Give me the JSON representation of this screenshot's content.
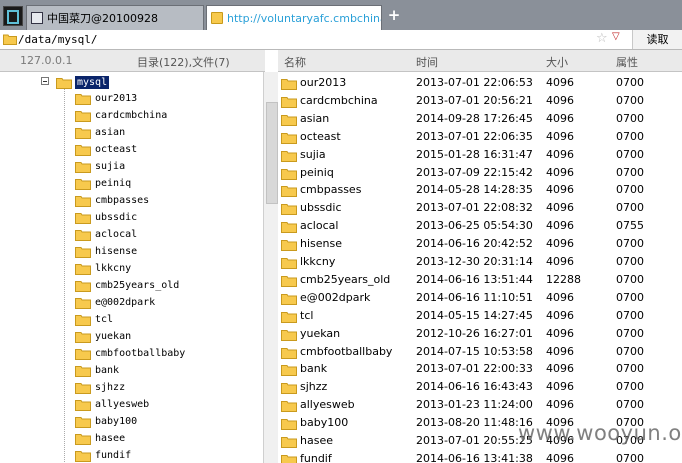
{
  "tabs": [
    {
      "label": "中国菜刀@20100928"
    },
    {
      "label": "http://voluntaryafc.cmbchina...."
    }
  ],
  "new_tab_label": "+",
  "address": {
    "value": "/data/mysql/",
    "star": "☆",
    "caret": "▽",
    "read_button": "读取"
  },
  "left_header": {
    "host": "127.0.0.1",
    "counts": "目录(122),文件(7)"
  },
  "columns": {
    "name": "名称",
    "time": "时间",
    "size": "大小",
    "perm": "属性"
  },
  "tree": {
    "root": "mysql",
    "children": [
      "our2013",
      "cardcmbchina",
      "asian",
      "octeast",
      "sujia",
      "peiniq",
      "cmbpasses",
      "ubssdic",
      "aclocal",
      "hisense",
      "lkkcny",
      "cmb25years_old",
      "e@002dpark",
      "tcl",
      "yuekan",
      "cmbfootballbaby",
      "bank",
      "sjhzz",
      "allyesweb",
      "baby100",
      "hasee",
      "fundif"
    ]
  },
  "files": [
    {
      "name": "our2013",
      "time": "2013-07-01 22:06:53",
      "size": "4096",
      "perm": "0700"
    },
    {
      "name": "cardcmbchina",
      "time": "2013-07-01 20:56:21",
      "size": "4096",
      "perm": "0700"
    },
    {
      "name": "asian",
      "time": "2014-09-28 17:26:45",
      "size": "4096",
      "perm": "0700"
    },
    {
      "name": "octeast",
      "time": "2013-07-01 22:06:35",
      "size": "4096",
      "perm": "0700"
    },
    {
      "name": "sujia",
      "time": "2015-01-28 16:31:47",
      "size": "4096",
      "perm": "0700"
    },
    {
      "name": "peiniq",
      "time": "2013-07-09 22:15:42",
      "size": "4096",
      "perm": "0700"
    },
    {
      "name": "cmbpasses",
      "time": "2014-05-28 14:28:35",
      "size": "4096",
      "perm": "0700"
    },
    {
      "name": "ubssdic",
      "time": "2013-07-01 22:08:32",
      "size": "4096",
      "perm": "0700"
    },
    {
      "name": "aclocal",
      "time": "2013-06-25 05:54:30",
      "size": "4096",
      "perm": "0755"
    },
    {
      "name": "hisense",
      "time": "2014-06-16 20:42:52",
      "size": "4096",
      "perm": "0700"
    },
    {
      "name": "lkkcny",
      "time": "2013-12-30 20:31:14",
      "size": "4096",
      "perm": "0700"
    },
    {
      "name": "cmb25years_old",
      "time": "2014-06-16 13:51:44",
      "size": "12288",
      "perm": "0700"
    },
    {
      "name": "e@002dpark",
      "time": "2014-06-16 11:10:51",
      "size": "4096",
      "perm": "0700"
    },
    {
      "name": "tcl",
      "time": "2014-05-15 14:27:45",
      "size": "4096",
      "perm": "0700"
    },
    {
      "name": "yuekan",
      "time": "2012-10-26 16:27:01",
      "size": "4096",
      "perm": "0700"
    },
    {
      "name": "cmbfootballbaby",
      "time": "2014-07-15 10:53:58",
      "size": "4096",
      "perm": "0700"
    },
    {
      "name": "bank",
      "time": "2013-07-01 22:00:33",
      "size": "4096",
      "perm": "0700"
    },
    {
      "name": "sjhzz",
      "time": "2014-06-16 16:43:43",
      "size": "4096",
      "perm": "0700"
    },
    {
      "name": "allyesweb",
      "time": "2013-01-23 11:24:00",
      "size": "4096",
      "perm": "0700"
    },
    {
      "name": "baby100",
      "time": "2013-08-20 11:48:16",
      "size": "4096",
      "perm": "0700"
    },
    {
      "name": "hasee",
      "time": "2013-07-01 20:55:25",
      "size": "4096",
      "perm": "0700"
    },
    {
      "name": "fundif",
      "time": "2014-06-16 13:41:38",
      "size": "4096",
      "perm": "0700"
    }
  ],
  "watermark": "www.wooyun.org",
  "colors": {
    "folder": "#f7c94d",
    "folder_edge": "#c99a1e",
    "selection": "#0a246a",
    "link": "#2aa0d8"
  },
  "icons": {
    "folder": "folder-icon",
    "close": "close-icon",
    "app": "app-icon"
  }
}
